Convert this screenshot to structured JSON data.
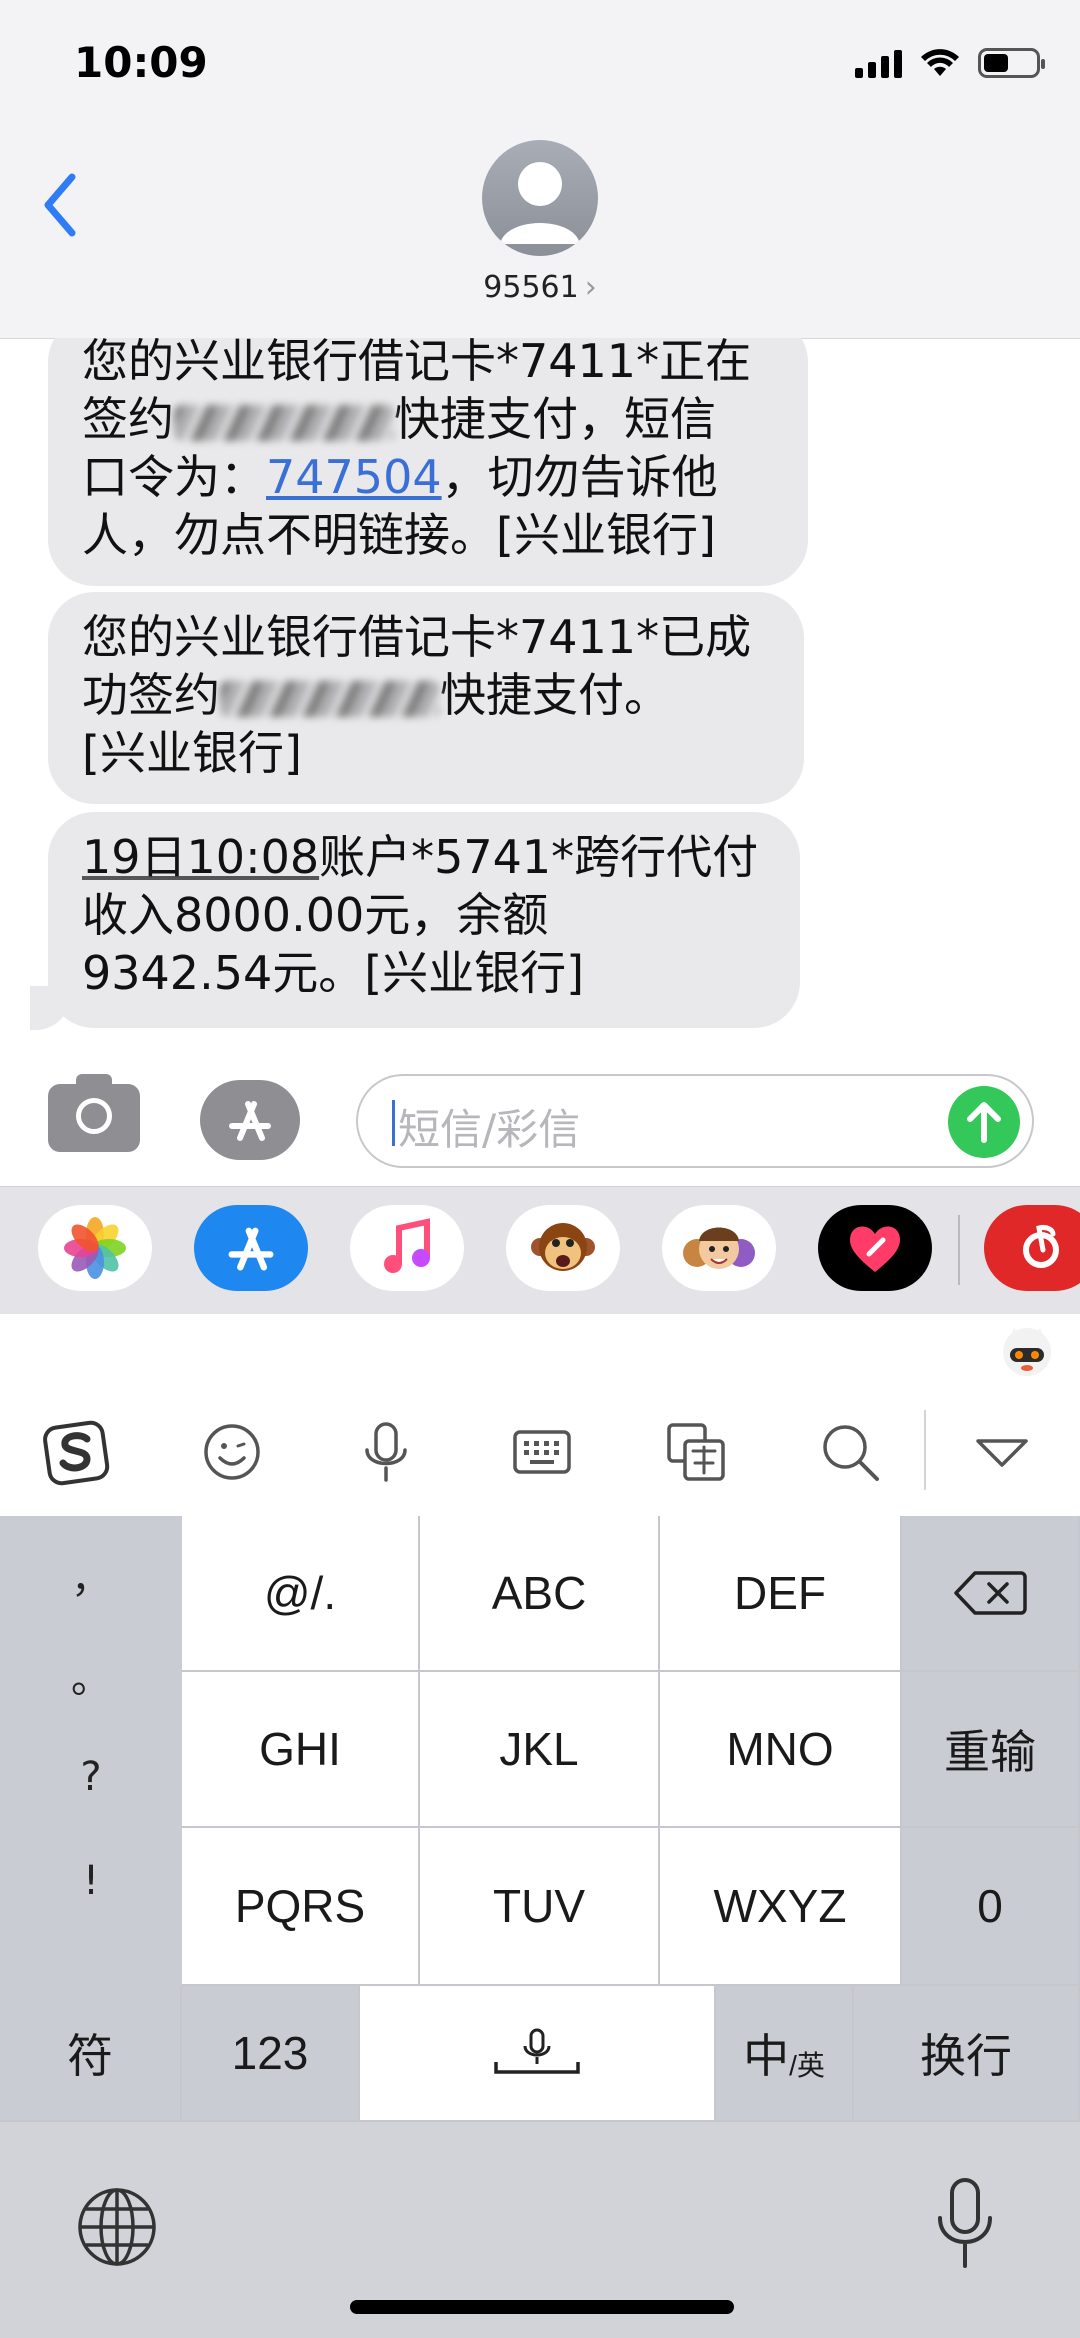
{
  "status_bar": {
    "time": "10:09"
  },
  "header": {
    "contact": "95561",
    "chevron": "›"
  },
  "messages": [
    {
      "lines": [
        [
          "您的兴业银行借记卡*7411*正在"
        ],
        [
          "签约",
          "[REDACTED]",
          "快捷支付，短信"
        ],
        [
          "口令为：",
          "747504",
          "，切勿告诉他"
        ],
        [
          "人，勿点不明链接。[兴业银行]"
        ]
      ]
    },
    {
      "lines": [
        [
          "您的兴业银行借记卡*7411*已成"
        ],
        [
          "功签约",
          "[REDACTED]",
          "快捷支付。"
        ],
        [
          "[兴业银行]"
        ]
      ]
    },
    {
      "lines": [
        [
          "19日10:08",
          "账户*5741*跨行代付"
        ],
        [
          "收入8000.00元，余额"
        ],
        [
          "9342.54元。[兴业银行]"
        ]
      ]
    }
  ],
  "composer": {
    "placeholder": "短信/彩信"
  },
  "keyboard": {
    "punct": [
      "，",
      "。",
      "?",
      "!"
    ],
    "row1": [
      "@/.",
      "ABC",
      "DEF"
    ],
    "row2": [
      "GHI",
      "JKL",
      "MNO",
      "重输"
    ],
    "row3": [
      "PQRS",
      "TUV",
      "WXYZ",
      "0"
    ],
    "bottom": {
      "symbols": "符",
      "numbers": "123",
      "lang_main": "中",
      "lang_sub": "/英",
      "return": "换行"
    }
  },
  "colors": {
    "link": "#3a6fd6",
    "send": "#34c759",
    "back": "#2f7cf6",
    "bubble": "#e9e9eb"
  },
  "icons": [
    "chevron-left-icon",
    "avatar-icon",
    "camera-icon",
    "appstore-icon",
    "send-arrow-icon",
    "photos-icon",
    "appstore-icon",
    "music-icon",
    "monkey-animoji-icon",
    "memoji-icon",
    "heart-icon",
    "netease-music-icon",
    "sogou-logo-icon",
    "emoji-icon",
    "mic-icon",
    "keyboard-icon",
    "translate-icon",
    "search-icon",
    "collapse-triangle-icon",
    "delete-icon",
    "globe-icon",
    "dictation-mic-icon"
  ]
}
